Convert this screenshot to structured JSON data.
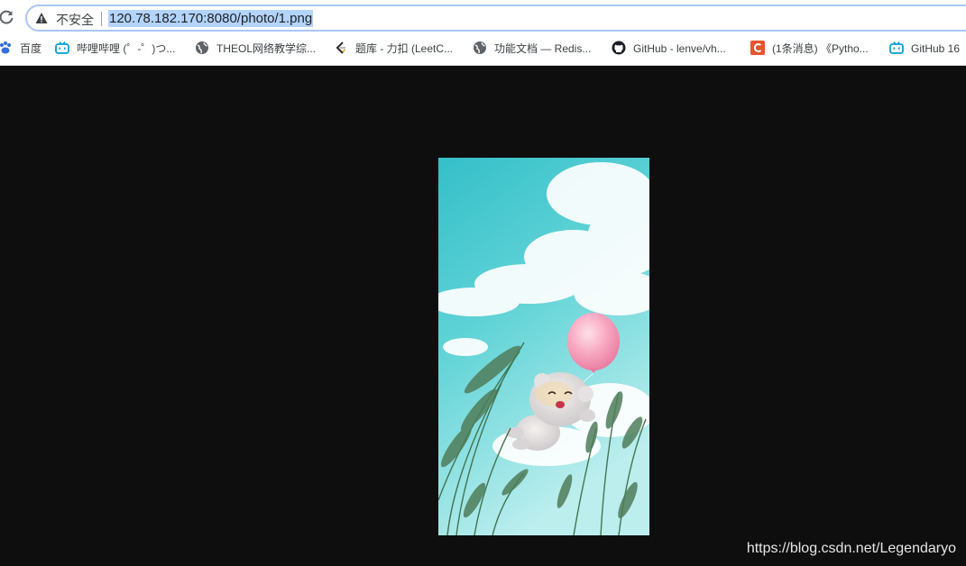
{
  "browser": {
    "insecure_label": "不安全",
    "url": "120.78.182.170:8080/photo/1.png"
  },
  "bookmarks": [
    {
      "label": "百度",
      "icon": "baidu-paw-icon"
    },
    {
      "label": "哔哩哔哩 (゜-゜)つ...",
      "icon": "bilibili-tv-icon"
    },
    {
      "label": "THEOL网络教学综...",
      "icon": "globe-icon"
    },
    {
      "label": "题库 - 力扣 (LeetC...",
      "icon": "leetcode-icon"
    },
    {
      "label": "功能文档 — Redis...",
      "icon": "globe-icon"
    },
    {
      "label": "GitHub - lenve/vh...",
      "icon": "github-icon"
    },
    {
      "label": "(1条消息) 《Pytho...",
      "icon": "csdn-c-icon"
    },
    {
      "label": "GitHub 16",
      "icon": "bilibili-tv-icon"
    }
  ],
  "watermark": "https://blog.csdn.net/Legendaryo",
  "colors": {
    "background": "#0e0e0e",
    "url_highlight": "#b3d4fc",
    "omnibox_border": "#a8c7fa",
    "balloon": "#f7a1bd",
    "sky": "#3cc4cf"
  }
}
